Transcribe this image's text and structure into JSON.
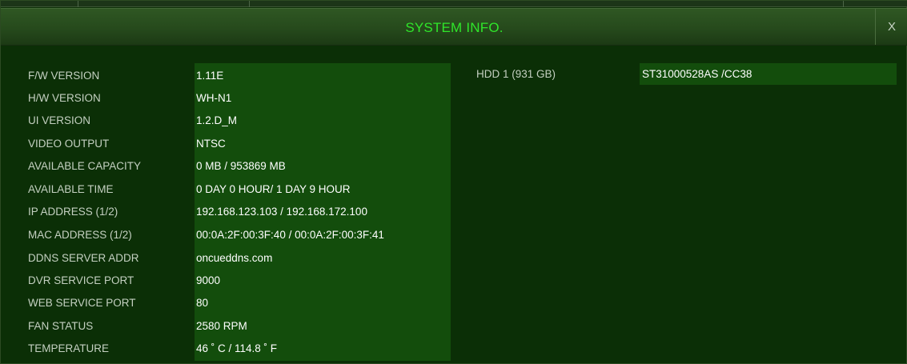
{
  "window": {
    "title": "SYSTEM INFO.",
    "close_label": "X"
  },
  "info": [
    {
      "label": "F/W VERSION",
      "value": "1.11E"
    },
    {
      "label": "H/W VERSION",
      "value": "WH-N1"
    },
    {
      "label": "UI VERSION",
      "value": "1.2.D_M"
    },
    {
      "label": "VIDEO OUTPUT",
      "value": "NTSC"
    },
    {
      "label": "AVAILABLE CAPACITY",
      "value": "0 MB / 953869 MB"
    },
    {
      "label": "AVAILABLE TIME",
      "value": "0 DAY 0 HOUR/ 1 DAY 9 HOUR"
    },
    {
      "label": "IP ADDRESS (1/2)",
      "value": "192.168.123.103 / 192.168.172.100"
    },
    {
      "label": "MAC ADDRESS (1/2)",
      "value": "00:0A:2F:00:3F:40 / 00:0A:2F:00:3F:41"
    },
    {
      "label": "DDNS SERVER ADDR",
      "value": "oncueddns.com"
    },
    {
      "label": "DVR SERVICE PORT",
      "value": "9000"
    },
    {
      "label": "WEB SERVICE PORT",
      "value": "80"
    },
    {
      "label": "FAN STATUS",
      "value": "2580 RPM"
    },
    {
      "label": "TEMPERATURE",
      "value": "46 ˚ C / 114.8 ˚ F"
    }
  ],
  "hdd": [
    {
      "label": "HDD 1 (931 GB)",
      "value": "ST31000528AS /CC38"
    }
  ],
  "colors": {
    "title_text": "#2fe62a",
    "window_bg": "#0b2f06",
    "value_panel_bg": "#134d0c",
    "label_text": "#c4d0c1",
    "value_text": "#ffffff"
  }
}
